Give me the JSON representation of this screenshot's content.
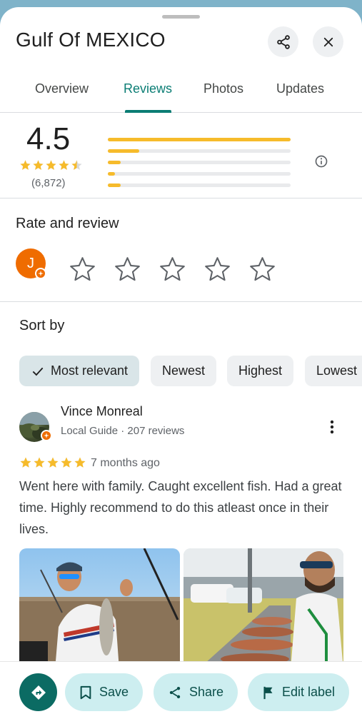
{
  "place": {
    "title": "Gulf Of MEXICO"
  },
  "header": {
    "share_icon": "share-icon",
    "close_icon": "close-icon"
  },
  "tabs": [
    {
      "label": "Overview",
      "active": false
    },
    {
      "label": "Reviews",
      "active": true
    },
    {
      "label": "Photos",
      "active": false
    },
    {
      "label": "Updates",
      "active": false
    }
  ],
  "summary": {
    "rating": "4.5",
    "stars": 4.5,
    "count": "(6,872)",
    "distribution": [
      {
        "stars": 5,
        "fraction": 1.0
      },
      {
        "stars": 4,
        "fraction": 0.17
      },
      {
        "stars": 3,
        "fraction": 0.07
      },
      {
        "stars": 2,
        "fraction": 0.04
      },
      {
        "stars": 1,
        "fraction": 0.07
      }
    ]
  },
  "rate_review": {
    "heading": "Rate and review",
    "user_initial": "J",
    "star_count": 5
  },
  "sort": {
    "label": "Sort by",
    "options": [
      "Most relevant",
      "Newest",
      "Highest",
      "Lowest"
    ],
    "selected": "Most relevant"
  },
  "review": {
    "name": "Vince Monreal",
    "meta": "Local Guide · 207 reviews",
    "stars": 5,
    "time": "7 months ago",
    "text": "Went here with family. Caught excellent fish. Had a great time. Highly recommend to do this atleast once in their lives."
  },
  "actions": {
    "save": "Save",
    "share": "Share",
    "edit_label": "Edit label"
  },
  "colors": {
    "accent": "#0b7d74",
    "star": "#f6bb2b",
    "avatar": "#ef6c00",
    "pill_bg": "#cdeef0"
  }
}
